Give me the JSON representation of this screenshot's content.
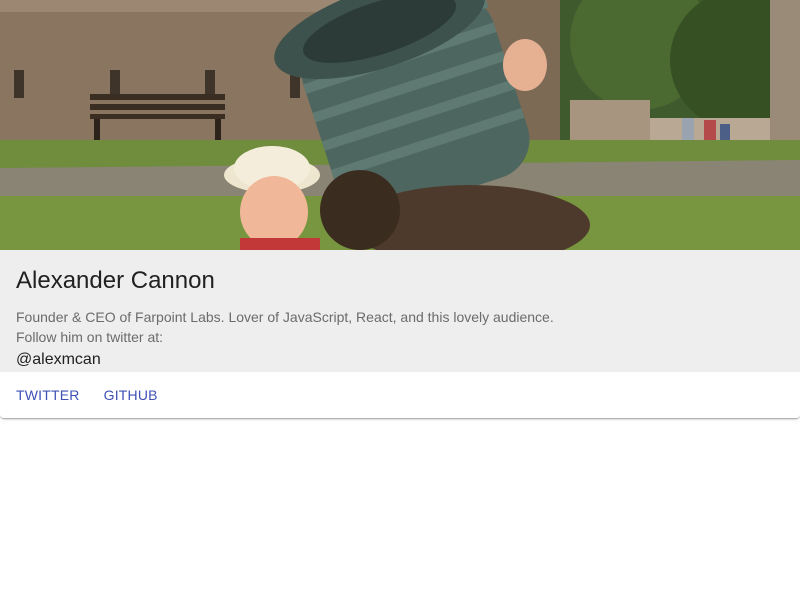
{
  "profile": {
    "name": "Alexander Cannon",
    "bio_line1": "Founder & CEO of Farpoint Labs. Lover of JavaScript, React, and this lovely audience.",
    "bio_line2": "Follow him on twitter at:",
    "handle": "@alexmcan"
  },
  "actions": {
    "twitter_label": "TWITTER",
    "github_label": "GITHUB"
  },
  "colors": {
    "accent": "#3f51b5",
    "content_bg": "#eeeeee"
  }
}
